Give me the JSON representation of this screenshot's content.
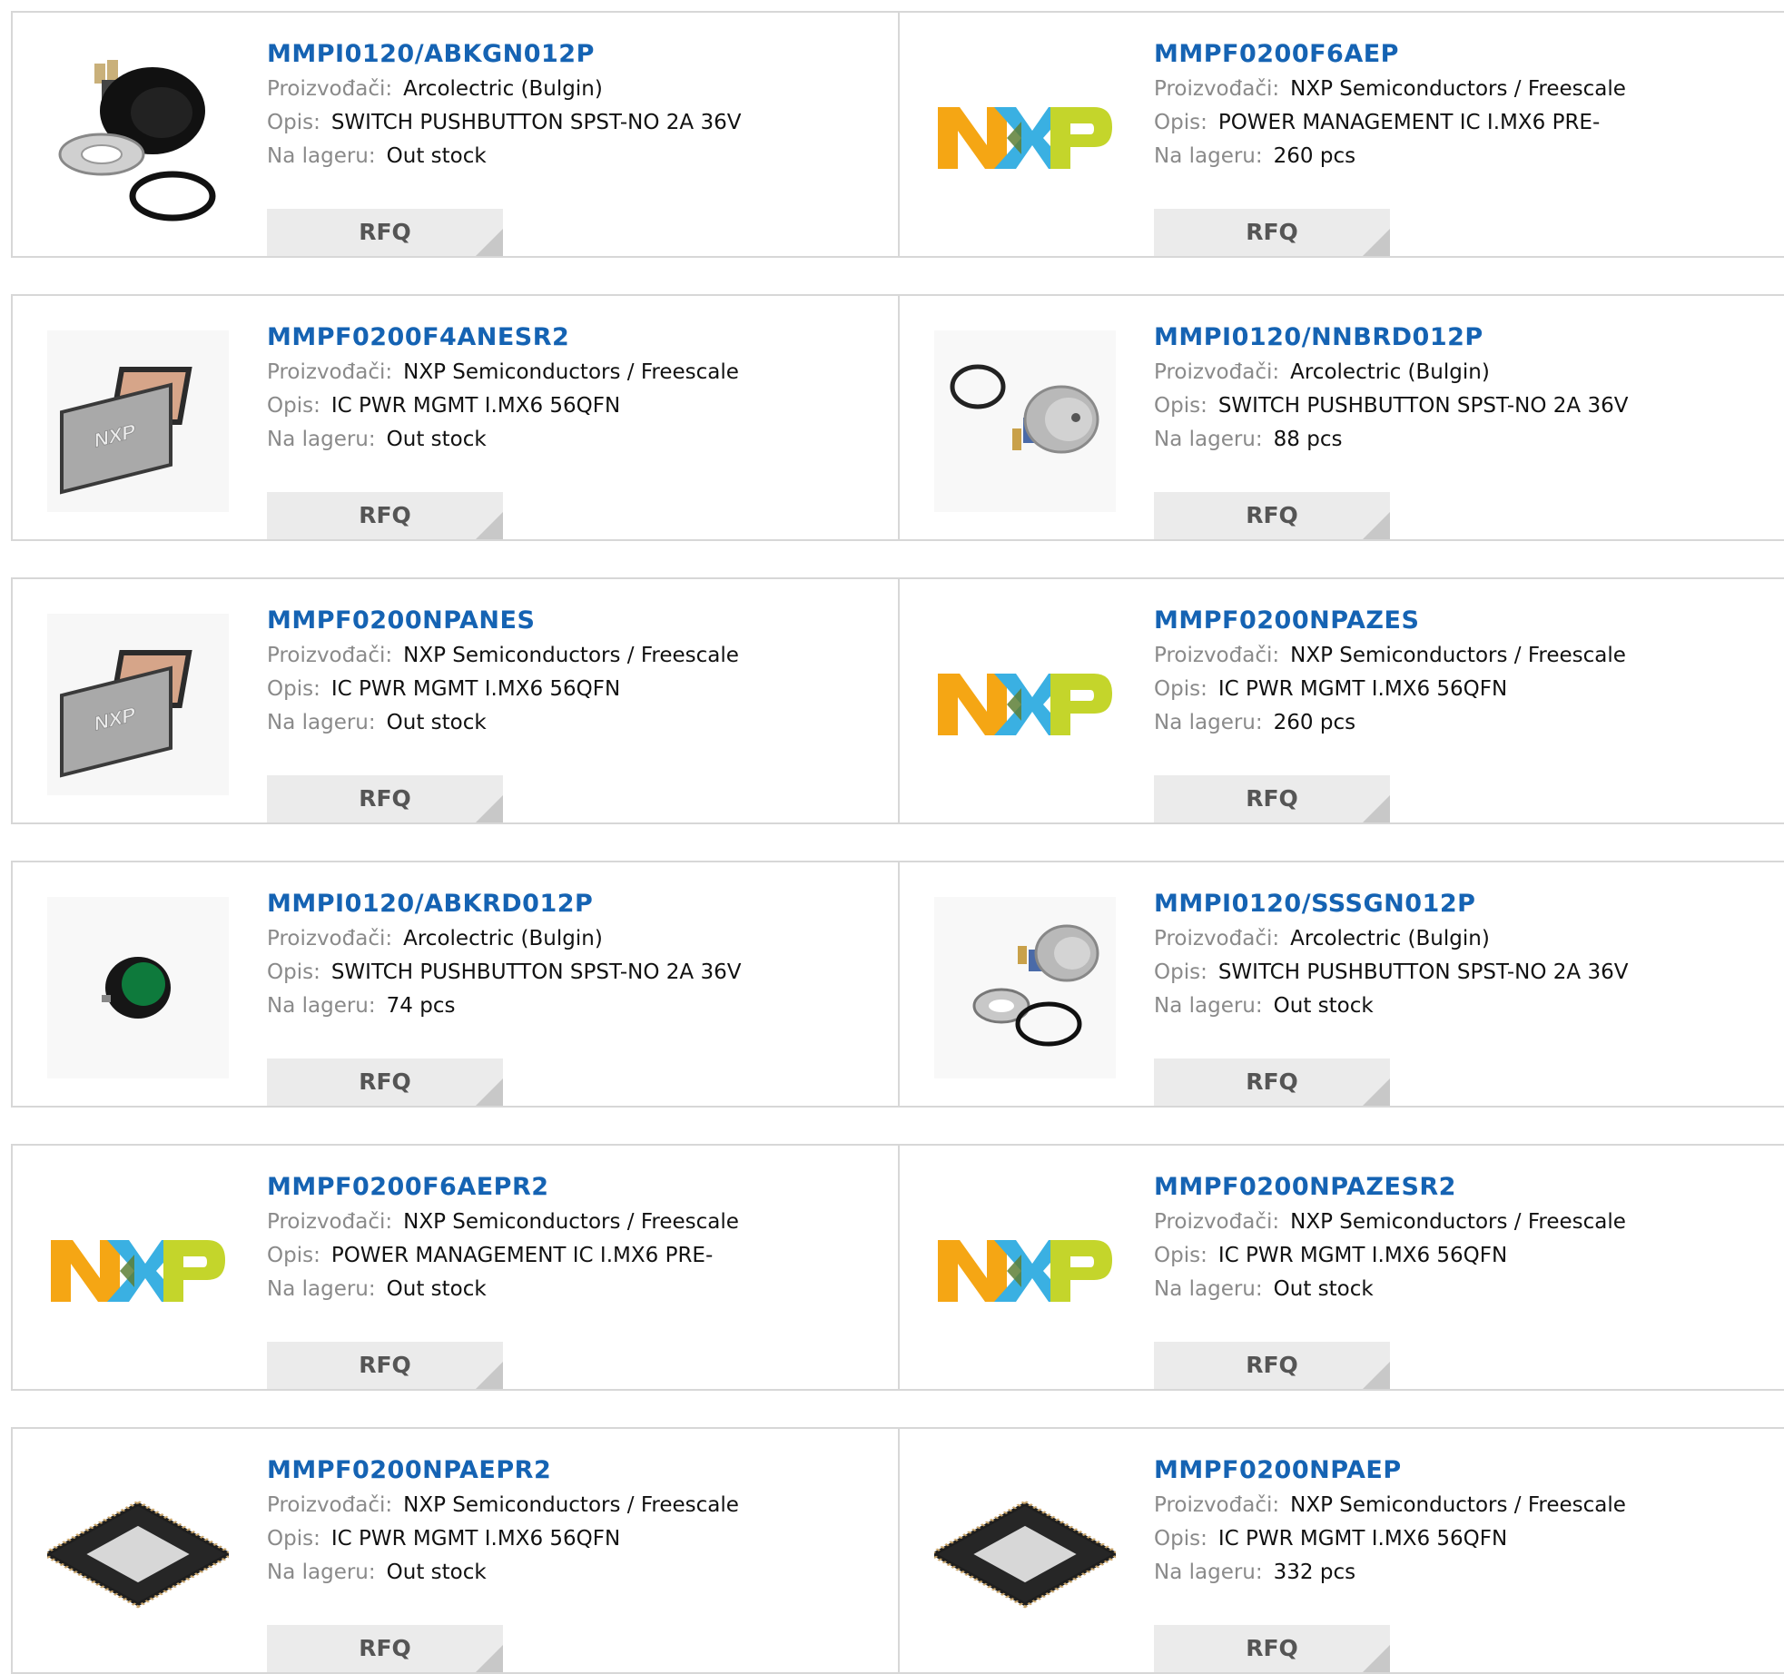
{
  "labels": {
    "manufacturer": "Proizvođači:",
    "description": "Opis:",
    "stock": "Na lageru:",
    "rfq": "RFQ"
  },
  "colors": {
    "title": "#1563b3",
    "label": "#8a8a8a",
    "button_bg": "#ebebeb",
    "nxp_orange": "#f5a614",
    "nxp_blue": "#3ab0e2",
    "nxp_green": "#c4d52b"
  },
  "products": [
    {
      "part": "MMPI0120/ABKGN012P",
      "manufacturer": "Arcolectric (Bulgin)",
      "description": "SWITCH PUSHBUTTON SPST-NO 2A 36V",
      "stock": "Out stock",
      "image": "black-pushbutton-with-nut-and-oring"
    },
    {
      "part": "MMPF0200F6AEP",
      "manufacturer": "NXP Semiconductors / Freescale",
      "description": "POWER MANAGEMENT IC I.MX6 PRE-",
      "stock": "260 pcs",
      "image": "nxp-logo"
    },
    {
      "part": "MMPF0200F4ANESR2",
      "manufacturer": "NXP Semiconductors / Freescale",
      "description": "IC PWR MGMT I.MX6 56QFN",
      "stock": "Out stock",
      "image": "nxp-qfn-chip-pair"
    },
    {
      "part": "MMPI0120/NNBRD012P",
      "manufacturer": "Arcolectric (Bulgin)",
      "description": "SWITCH PUSHBUTTON SPST-NO 2A 36V",
      "stock": "88 pcs",
      "image": "steel-pushbutton-with-oring"
    },
    {
      "part": "MMPF0200NPANES",
      "manufacturer": "NXP Semiconductors / Freescale",
      "description": "IC PWR MGMT I.MX6 56QFN",
      "stock": "Out stock",
      "image": "nxp-qfn-chip-pair"
    },
    {
      "part": "MMPF0200NPAZES",
      "manufacturer": "NXP Semiconductors / Freescale",
      "description": "IC PWR MGMT I.MX6 56QFN",
      "stock": "260 pcs",
      "image": "nxp-logo"
    },
    {
      "part": "MMPI0120/ABKRD012P",
      "manufacturer": "Arcolectric (Bulgin)",
      "description": "SWITCH PUSHBUTTON SPST-NO 2A 36V",
      "stock": "74 pcs",
      "image": "green-pushbutton"
    },
    {
      "part": "MMPI0120/SSSGN012P",
      "manufacturer": "Arcolectric (Bulgin)",
      "description": "SWITCH PUSHBUTTON SPST-NO 2A 36V",
      "stock": "Out stock",
      "image": "steel-pushbutton-with-nut-and-oring"
    },
    {
      "part": "MMPF0200F6AEPR2",
      "manufacturer": "NXP Semiconductors / Freescale",
      "description": "POWER MANAGEMENT IC I.MX6 PRE-",
      "stock": "Out stock",
      "image": "nxp-logo"
    },
    {
      "part": "MMPF0200NPAZESR2",
      "manufacturer": "NXP Semiconductors / Freescale",
      "description": "IC PWR MGMT I.MX6 56QFN",
      "stock": "Out stock",
      "image": "nxp-logo"
    },
    {
      "part": "MMPF0200NPAEPR2",
      "manufacturer": "NXP Semiconductors / Freescale",
      "description": "IC PWR MGMT I.MX6 56QFN",
      "stock": "Out stock",
      "image": "qfn-chip-black"
    },
    {
      "part": "MMPF0200NPAEP",
      "manufacturer": "NXP Semiconductors / Freescale",
      "description": "IC PWR MGMT I.MX6 56QFN",
      "stock": "332 pcs",
      "image": "qfn-chip-black"
    }
  ]
}
